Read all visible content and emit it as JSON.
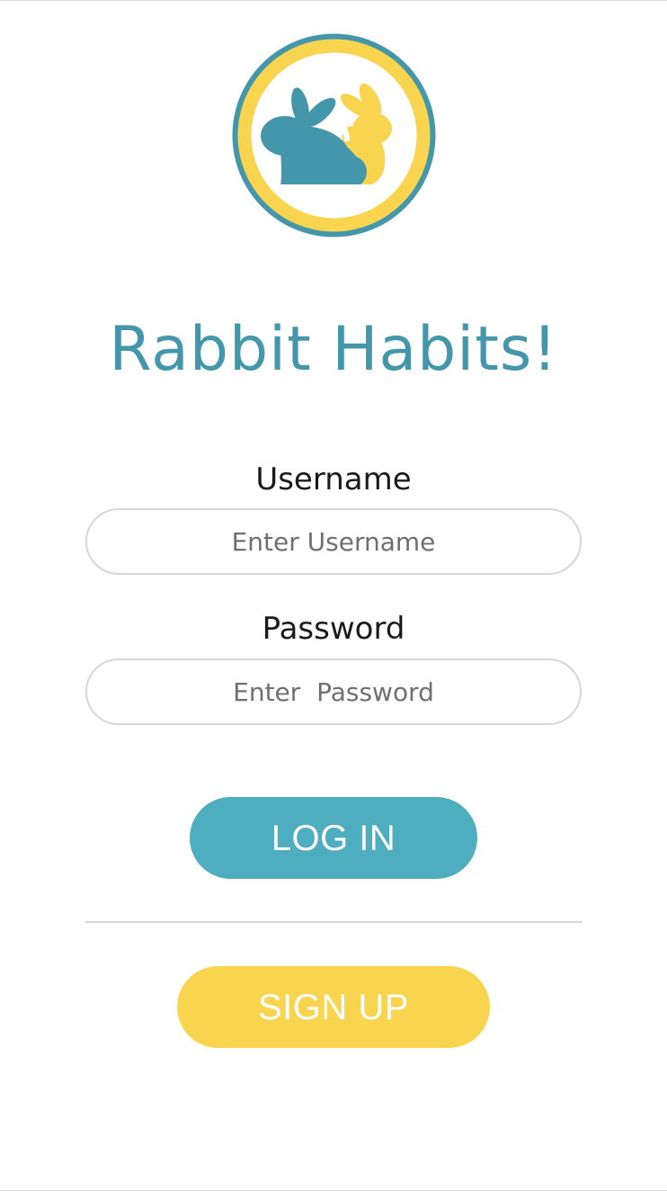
{
  "app": {
    "title": "Rabbit Habits!"
  },
  "colors": {
    "brand_teal": "#4497ab",
    "brand_yellow": "#f9d44f",
    "button_teal": "#4eaec0",
    "button_yellow": "#f9d44f",
    "logo_outer_ring": "#4497ab",
    "logo_inner_ring": "#f9d44f"
  },
  "logo": {
    "icon": "rabbit-pair-logo-icon"
  },
  "form": {
    "username_label": "Username",
    "username_placeholder": "Enter Username",
    "username_value": "",
    "password_label": "Password",
    "password_placeholder": "Enter  Password",
    "password_value": ""
  },
  "actions": {
    "login_label": "LOG IN",
    "signup_label": "SIGN UP"
  }
}
